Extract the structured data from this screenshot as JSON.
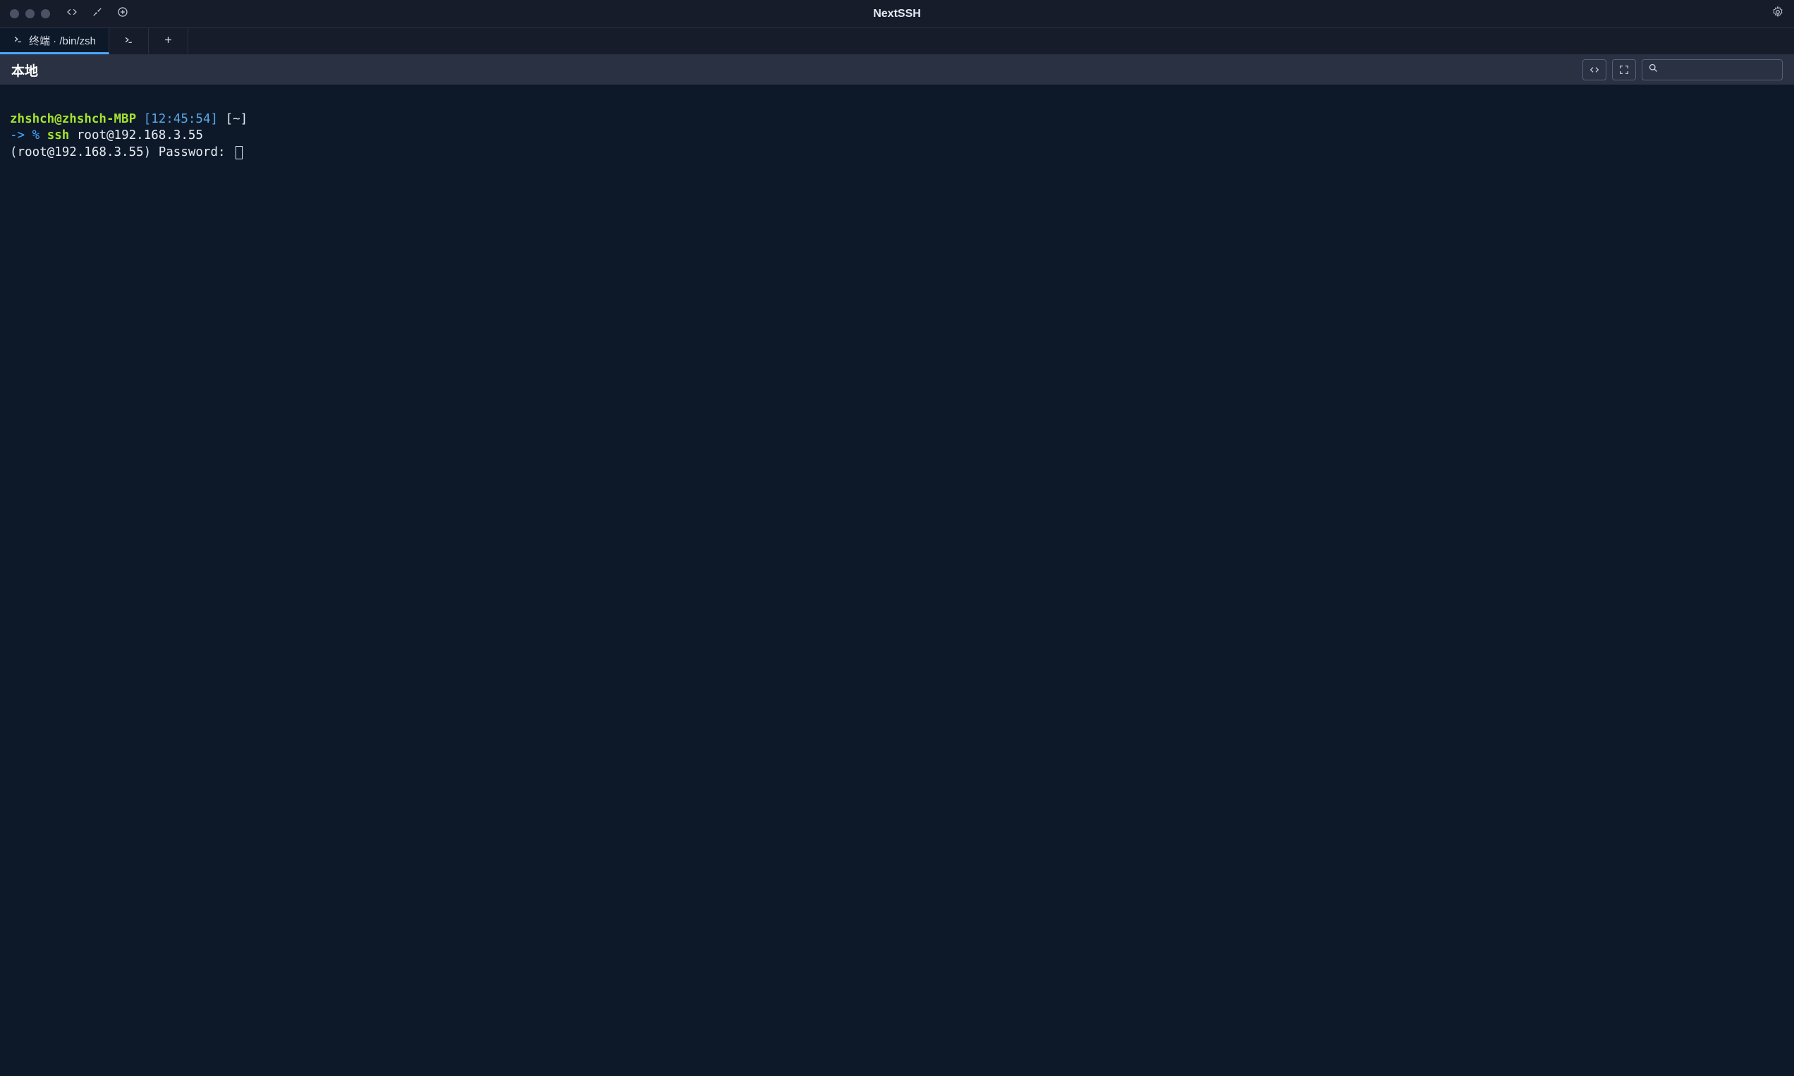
{
  "app": {
    "title": "NextSSH"
  },
  "tabs": [
    {
      "label": "终端 · /bin/zsh",
      "active": true
    },
    {
      "label": "",
      "icon_only": true
    },
    {
      "label": "",
      "add": true
    }
  ],
  "toolbar": {
    "title": "本地"
  },
  "search": {
    "value": "",
    "placeholder": ""
  },
  "terminal": {
    "line1": {
      "userhost": "zhshch@zhshch-MBP",
      "time": "[12:45:54]",
      "path": "[~]"
    },
    "line2": {
      "arrow": "->",
      "prompt": "%",
      "cmd": "ssh",
      "arg": "root@192.168.3.55"
    },
    "line3": {
      "text": "(root@192.168.3.55) Password:"
    }
  }
}
